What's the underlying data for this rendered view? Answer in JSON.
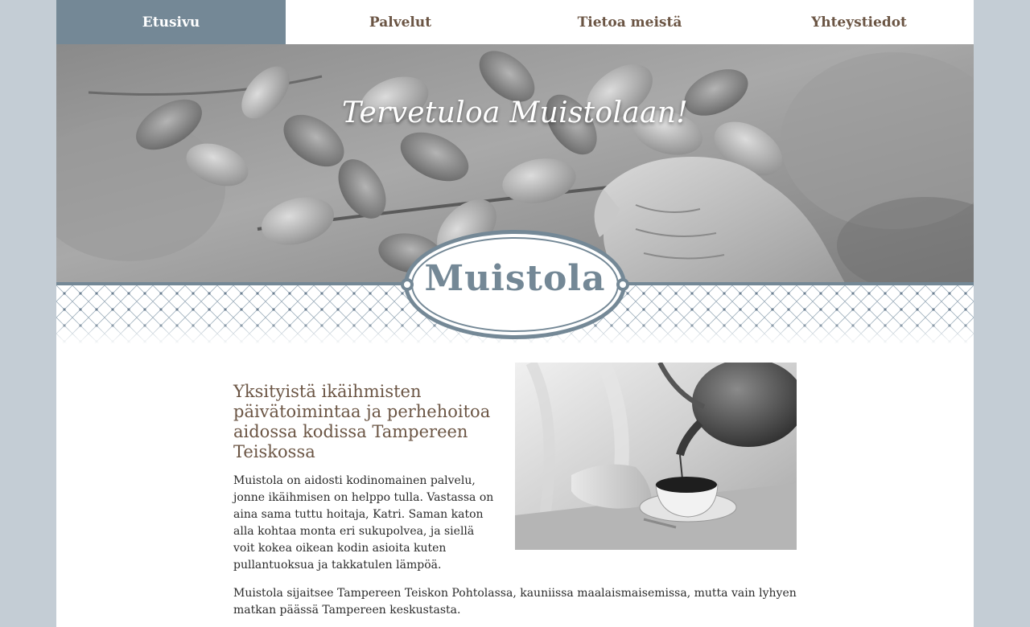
{
  "nav": {
    "items": [
      {
        "label": "Etusivu",
        "active": true
      },
      {
        "label": "Palvelut",
        "active": false
      },
      {
        "label": "Tietoa meistä",
        "active": false
      },
      {
        "label": "Yhteystiedot",
        "active": false
      }
    ]
  },
  "hero": {
    "title": "Tervetuloa Muistolaan!"
  },
  "logo": {
    "text": "Muistola"
  },
  "content": {
    "heading": "Yksityistä ikäihmisten päivätoimintaa ja perhehoitoa aidossa kodissa Tampereen Teiskossa",
    "paragraph1": "Muistola on aidosti kodinomainen palvelu, jonne ikäihmisen on helppo tulla. Vastassa on aina sama tuttu hoitaja, Katri. Saman katon alla kohtaa monta eri sukupolvea, ja siellä voit kokea oikean kodin asioita kuten pullantuoksua ja takkatulen lämpöä.",
    "paragraph2": "Muistola sijaitsee Tampereen Teiskon Pohtolassa, kauniissa maalaismaisemissa, mutta vain lyhyen matkan päässä Tampereen keskustasta."
  },
  "colors": {
    "accent": "#748896",
    "heading_brown": "#6b5544",
    "background": "#c4cdd5"
  },
  "images": {
    "hero": "grayscale-birch-leaves-hand",
    "content": "grayscale-coffee-pouring-cup"
  }
}
